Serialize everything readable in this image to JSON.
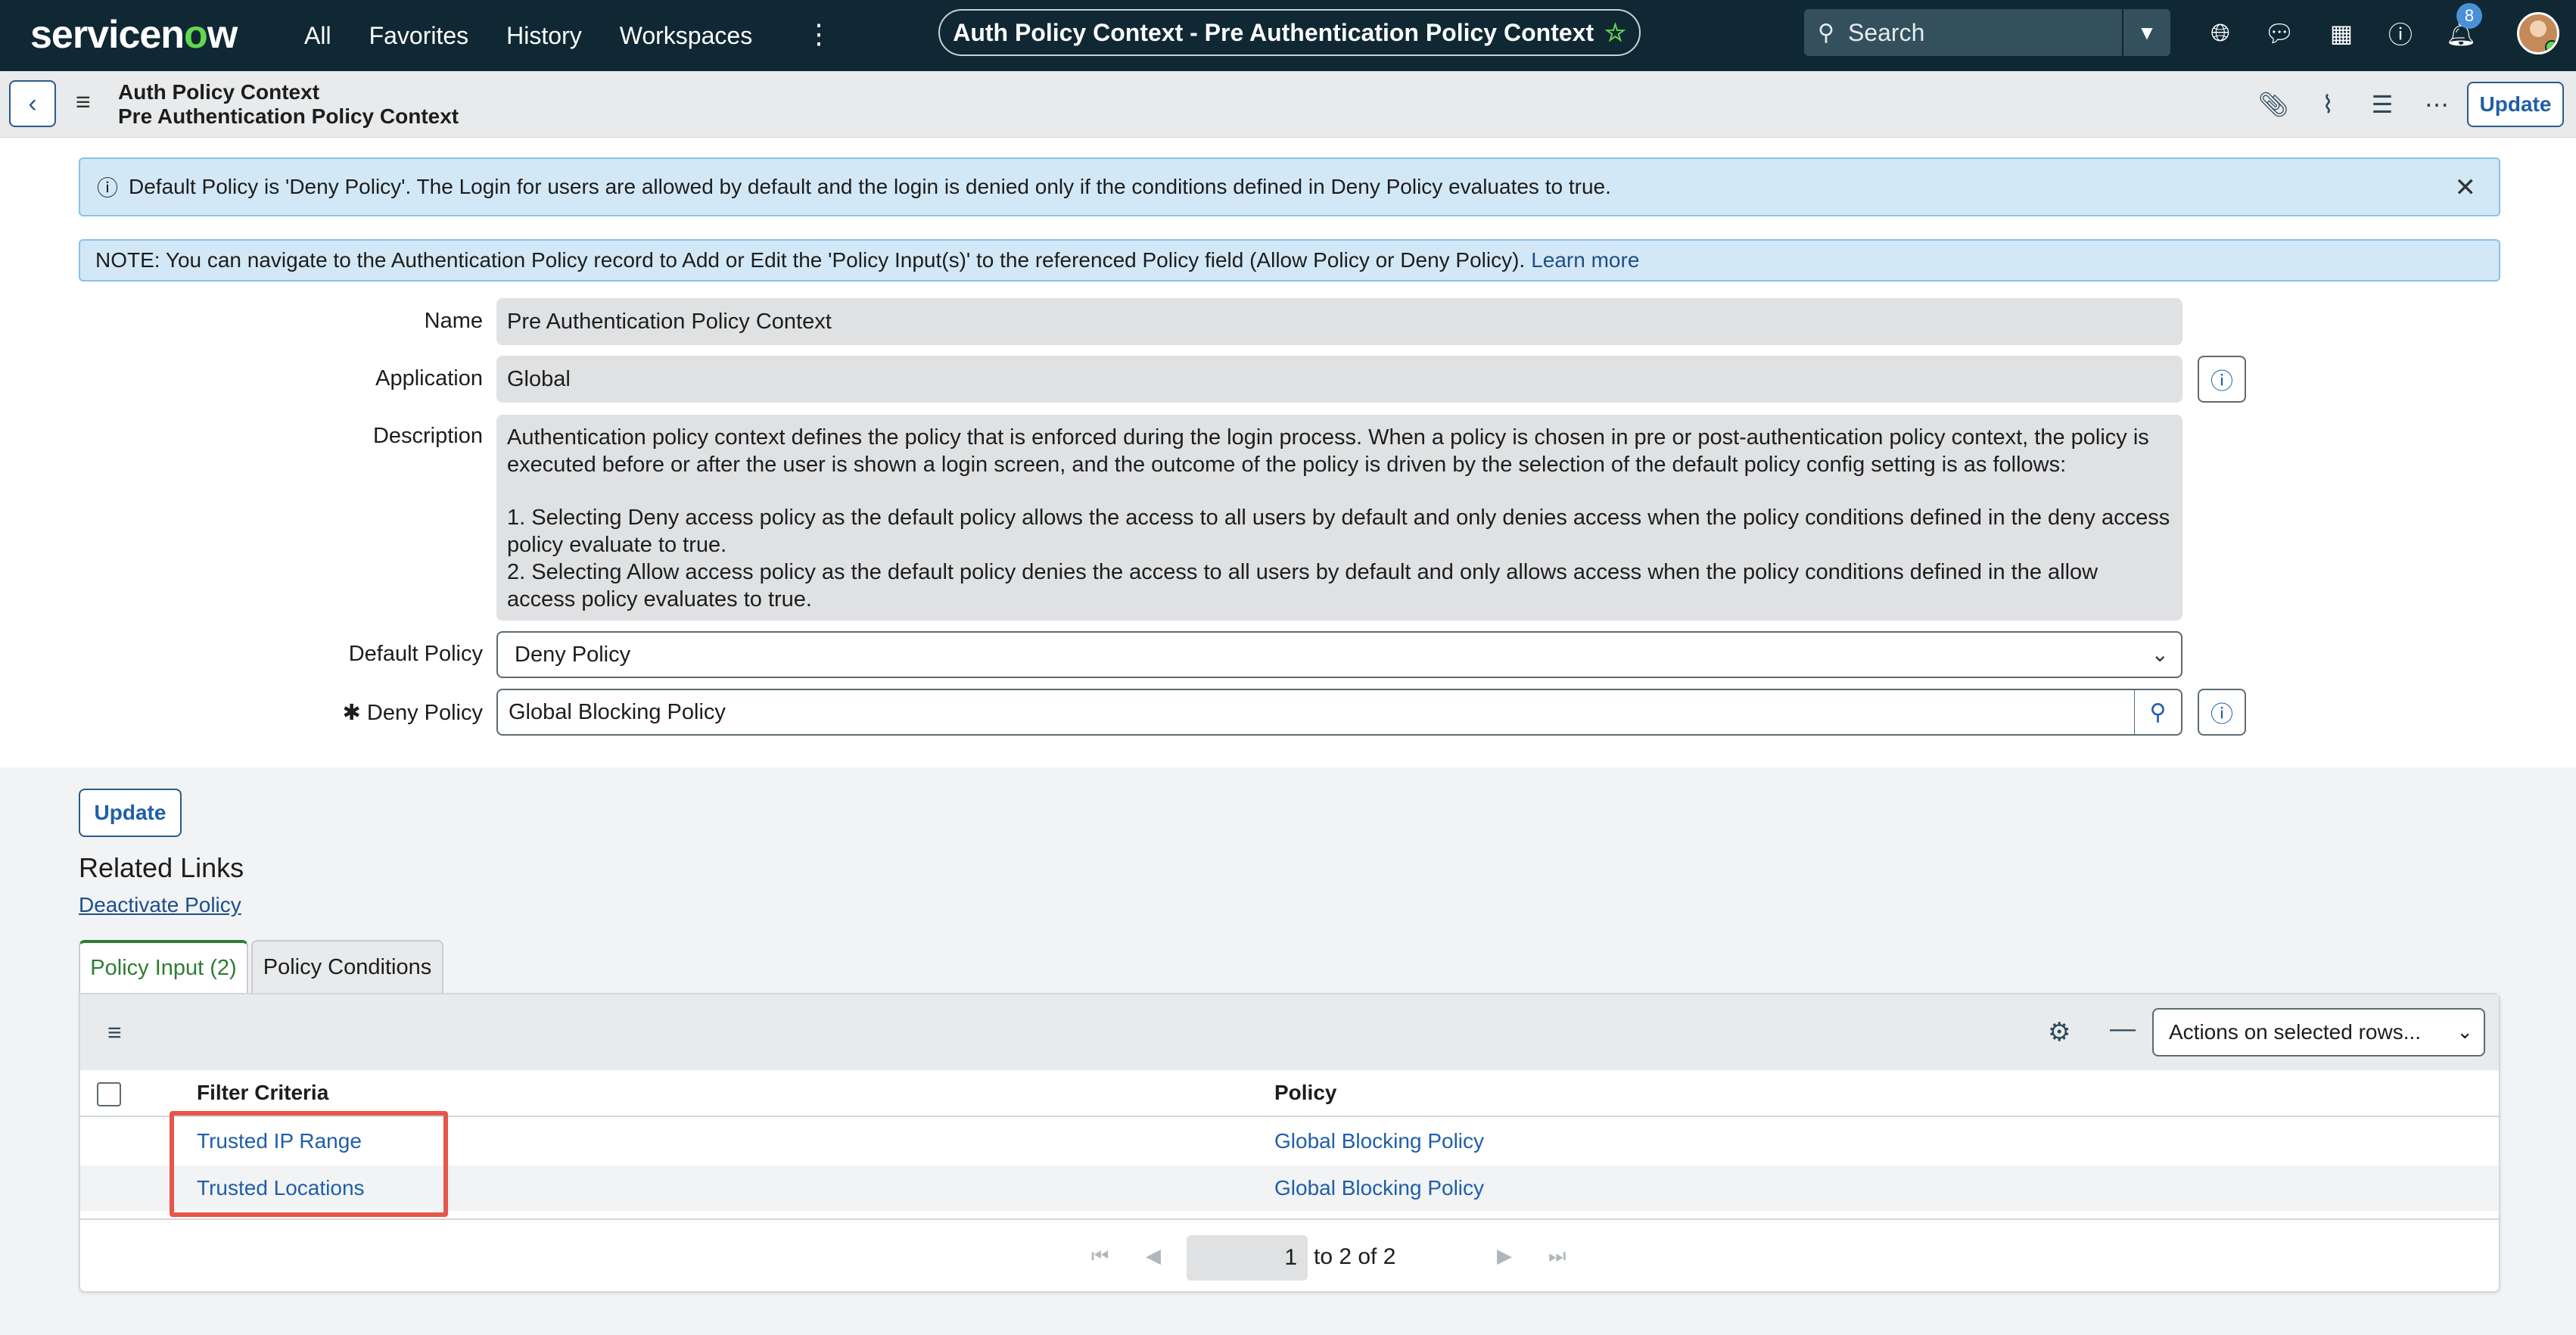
{
  "nav": {
    "logo_prefix": "servicen",
    "logo_o": "o",
    "logo_suffix": "w",
    "links": [
      "All",
      "Favorites",
      "History",
      "Workspaces"
    ],
    "context_title": "Auth Policy Context - Pre Authentication Policy Context",
    "search_placeholder": "Search",
    "notification_count": "8"
  },
  "header": {
    "table_name": "Auth Policy Context",
    "record_name": "Pre Authentication Policy Context",
    "update_label": "Update"
  },
  "banners": {
    "info": "Default Policy is 'Deny Policy'. The Login for users are allowed by default and the login is denied only if the conditions defined in Deny Policy evaluates to true.",
    "note": "NOTE: You can navigate to the Authentication Policy record to Add or Edit the 'Policy Input(s)' to the referenced Policy field (Allow Policy or Deny Policy).",
    "note_link": "Learn more"
  },
  "form": {
    "name_label": "Name",
    "name_value": "Pre Authentication Policy Context",
    "application_label": "Application",
    "application_value": "Global",
    "description_label": "Description",
    "description_p1": "Authentication policy context defines the policy that is enforced during the login process. When a policy is chosen in pre or post-authentication policy context, the policy is executed before or after the user is shown a login screen, and the outcome of the policy is driven by the selection of the default policy config setting is as follows:",
    "description_p2": "1. Selecting Deny access policy as the default policy allows the access to all users by default and only denies access when the policy conditions defined in the deny access policy evaluate to true.",
    "description_p3": "2. Selecting Allow access policy as the default policy denies the access to all users by default and only allows access when the policy conditions defined in the allow access policy evaluates to true.",
    "default_policy_label": "Default Policy",
    "default_policy_value": "Deny Policy",
    "required_mark": "✱",
    "deny_policy_label": "Deny Policy",
    "deny_policy_value": "Global Blocking Policy"
  },
  "footer_update_label": "Update",
  "related_links": {
    "title": "Related Links",
    "deactivate": "Deactivate Policy"
  },
  "tabs": [
    {
      "label": "Policy Input (2)"
    },
    {
      "label": "Policy Conditions"
    }
  ],
  "list": {
    "actions_label": "Actions on selected rows...",
    "columns": [
      "Filter Criteria",
      "Policy"
    ],
    "rows": [
      {
        "filter": "Trusted IP Range",
        "policy": "Global Blocking Policy"
      },
      {
        "filter": "Trusted Locations",
        "policy": "Global Blocking Policy"
      }
    ],
    "page_value": "1",
    "page_text": "to 2 of 2"
  },
  "colors": {
    "nav_bg": "#0f2834",
    "accent_green": "#62d84e",
    "link_blue": "#1f5fa8",
    "highlight_red": "#e6564a"
  }
}
